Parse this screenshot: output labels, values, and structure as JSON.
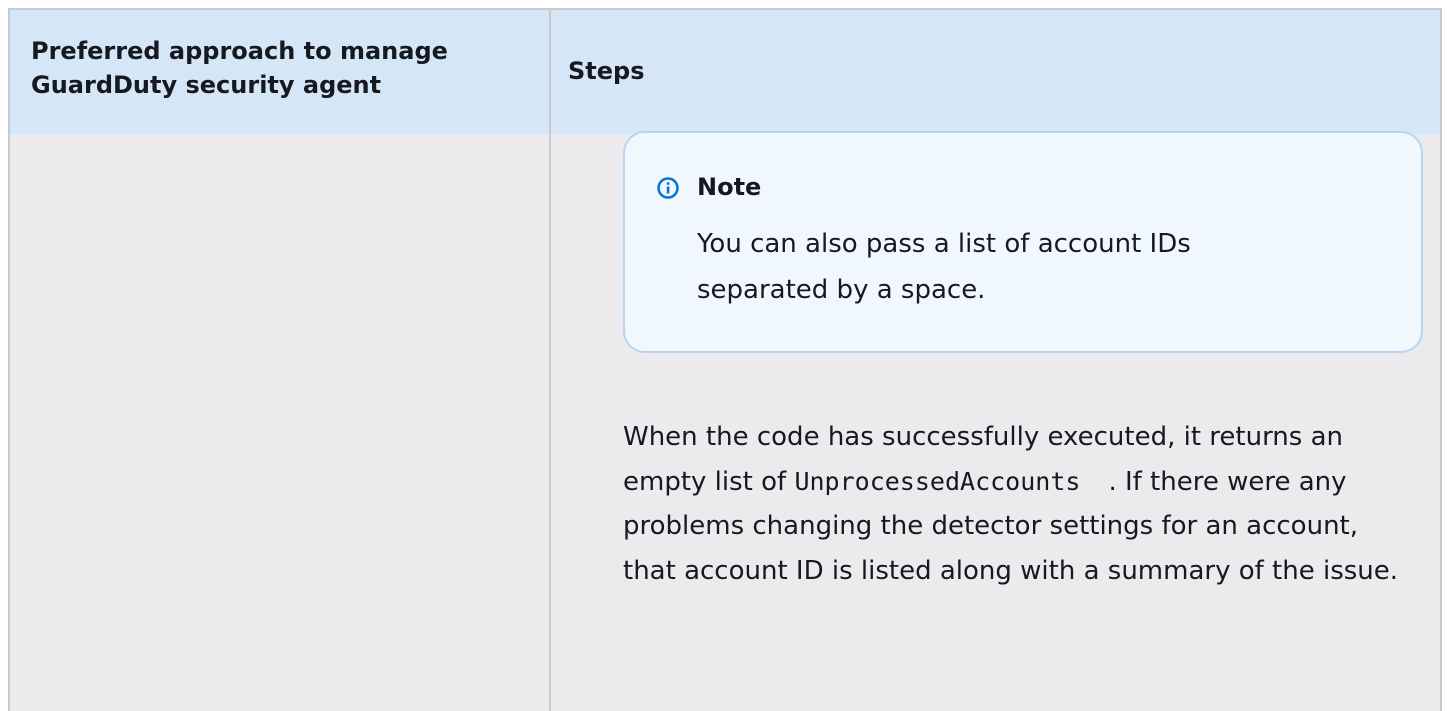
{
  "table": {
    "headers": {
      "approach": "Preferred approach to manage GuardDuty security agent",
      "steps": "Steps"
    }
  },
  "note": {
    "icon": "info-icon",
    "title": "Note",
    "text": "You can also pass a list of account IDs separated by a space."
  },
  "result": {
    "before_code": "When the code has successfully executed, it returns an empty list of ",
    "code": "UnprocessedAccounts",
    "after_code": ". If there were any problems changing the detector settings for an account, that account ID is listed along with a summary of the issue."
  },
  "colors": {
    "header_bg": "#d5e6f6",
    "row_bg": "#ebebed",
    "note_bg": "#f1f8fd",
    "note_border": "#b8d4ee",
    "info_icon": "#0972d3"
  }
}
